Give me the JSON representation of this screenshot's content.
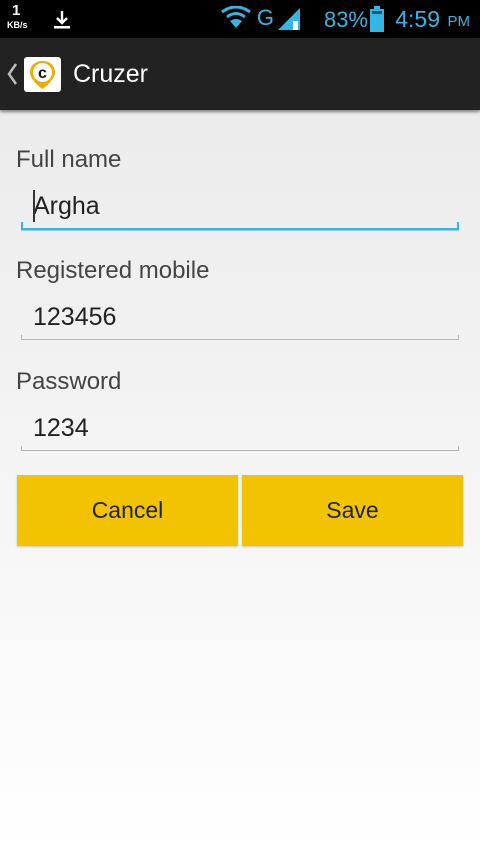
{
  "status_bar": {
    "speed_value": "1",
    "speed_unit": "KB/s",
    "network_type": "G",
    "battery_percent": "83%",
    "time": "4:59",
    "am_pm": "PM",
    "accent_color": "#33b5e5"
  },
  "action_bar": {
    "title": "Cruzer"
  },
  "form": {
    "full_name_label": "Full name",
    "full_name_value": "Argha",
    "mobile_label": "Registered mobile",
    "mobile_value": "123456",
    "password_label": "Password",
    "password_value": "1234"
  },
  "buttons": {
    "cancel_label": "Cancel",
    "save_label": "Save",
    "button_color": "#f2c300"
  }
}
